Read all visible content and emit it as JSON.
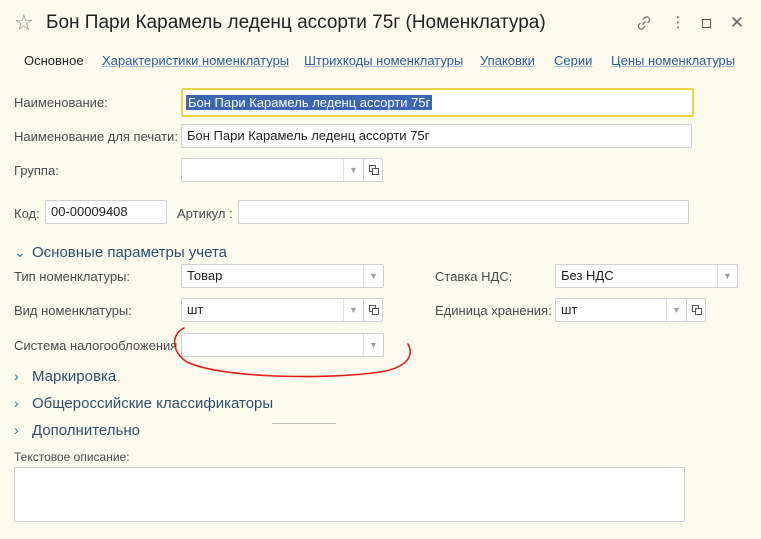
{
  "window": {
    "title": "Бон Пари Карамель леденц ассорти 75г (Номенклатура)"
  },
  "tabs": [
    {
      "label": "Основное"
    },
    {
      "label": "Характеристики номенклатуры"
    },
    {
      "label": "Штрихкоды номенклатуры"
    },
    {
      "label": "Упаковки"
    },
    {
      "label": "Серии"
    },
    {
      "label": "Цены номенклатуры"
    }
  ],
  "form": {
    "name_label": "Наименование:",
    "name_value": "Бон Пари Карамель леденц ассорти 75г",
    "print_name_label": "Наименование для печати:",
    "print_name_value": "Бон Пари Карамель леденц ассорти 75г",
    "group_label": "Группа:",
    "group_value": "",
    "code_label": "Код:",
    "code_value": "00-00009408",
    "article_label": "Артикул :",
    "article_value": ""
  },
  "accounting": {
    "section_label": "Основные параметры учета",
    "type_label": "Тип номенклатуры:",
    "type_value": "Товар",
    "vat_label": "Ставка НДС:",
    "vat_value": "Без НДС",
    "kind_label": "Вид номенклатуры:",
    "kind_value": "шт",
    "storage_unit_label": "Единица хранения:",
    "storage_unit_value": "шт",
    "tax_system_label": "Система налогообложения",
    "tax_system_value": ""
  },
  "sections": {
    "marking": "Маркировка",
    "classifiers": "Общероссийские классификаторы",
    "additional": "Дополнительно"
  },
  "description": {
    "label": "Текстовое описание:",
    "value": ""
  },
  "colors": {
    "background": "#fbfbee",
    "link": "#2a5d9c",
    "focus_border": "#e8d44a",
    "annotation": "#e0201c"
  }
}
